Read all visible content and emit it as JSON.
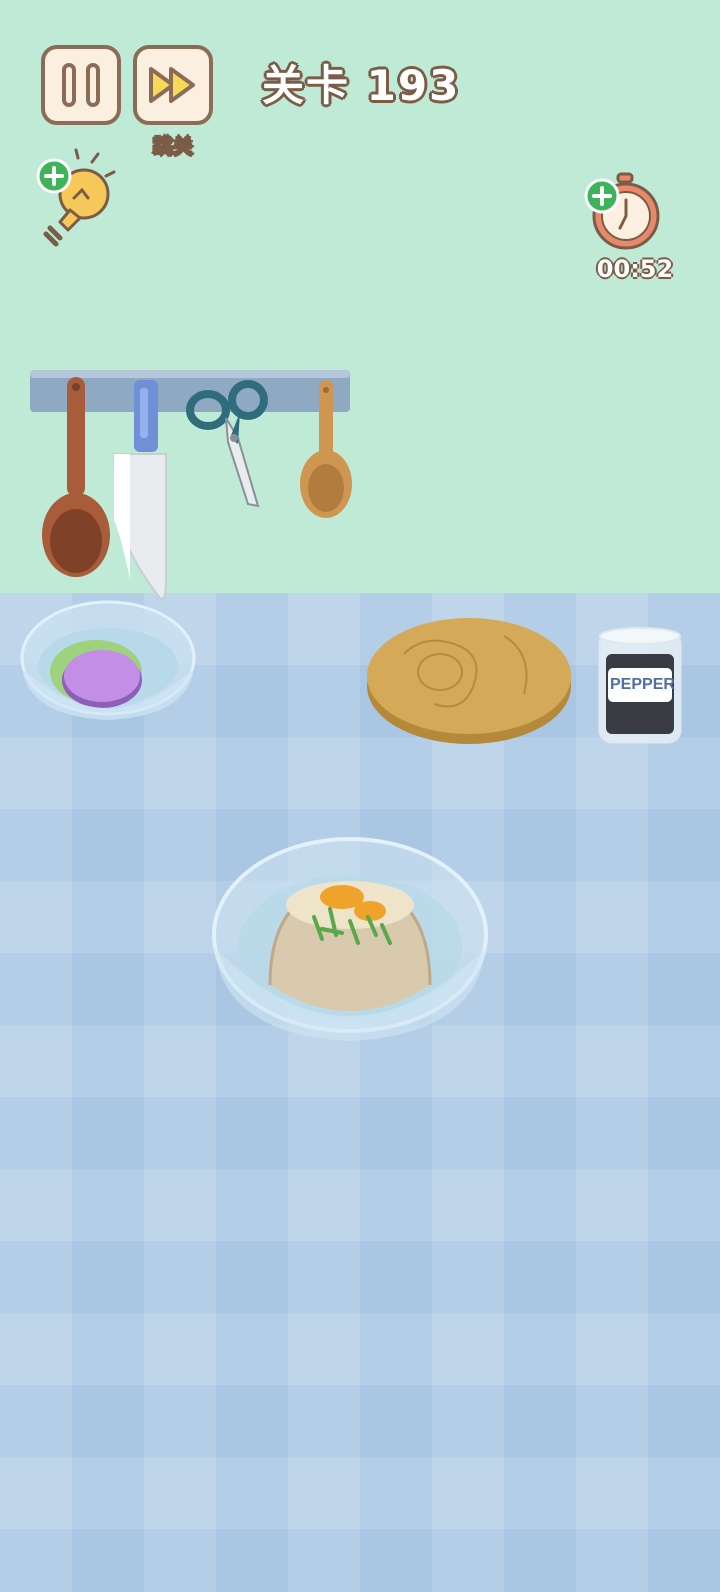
{
  "hud": {
    "skip_label": "跳关",
    "level_title": "关卡 193",
    "timer": "00:52"
  },
  "icons": {
    "pause": "pause-icon",
    "skip": "fast-forward-icon",
    "hint": "lightbulb-icon",
    "time_bonus": "stopwatch-icon",
    "add": "plus-icon"
  },
  "items": {
    "pepper_label": "PEPPER"
  },
  "colors": {
    "wall": "#bfead6",
    "table": "#a9c6e3",
    "hud_fill": "#fbefe0",
    "hud_outline": "#8b6d57",
    "add_badge": "#3db35a"
  }
}
